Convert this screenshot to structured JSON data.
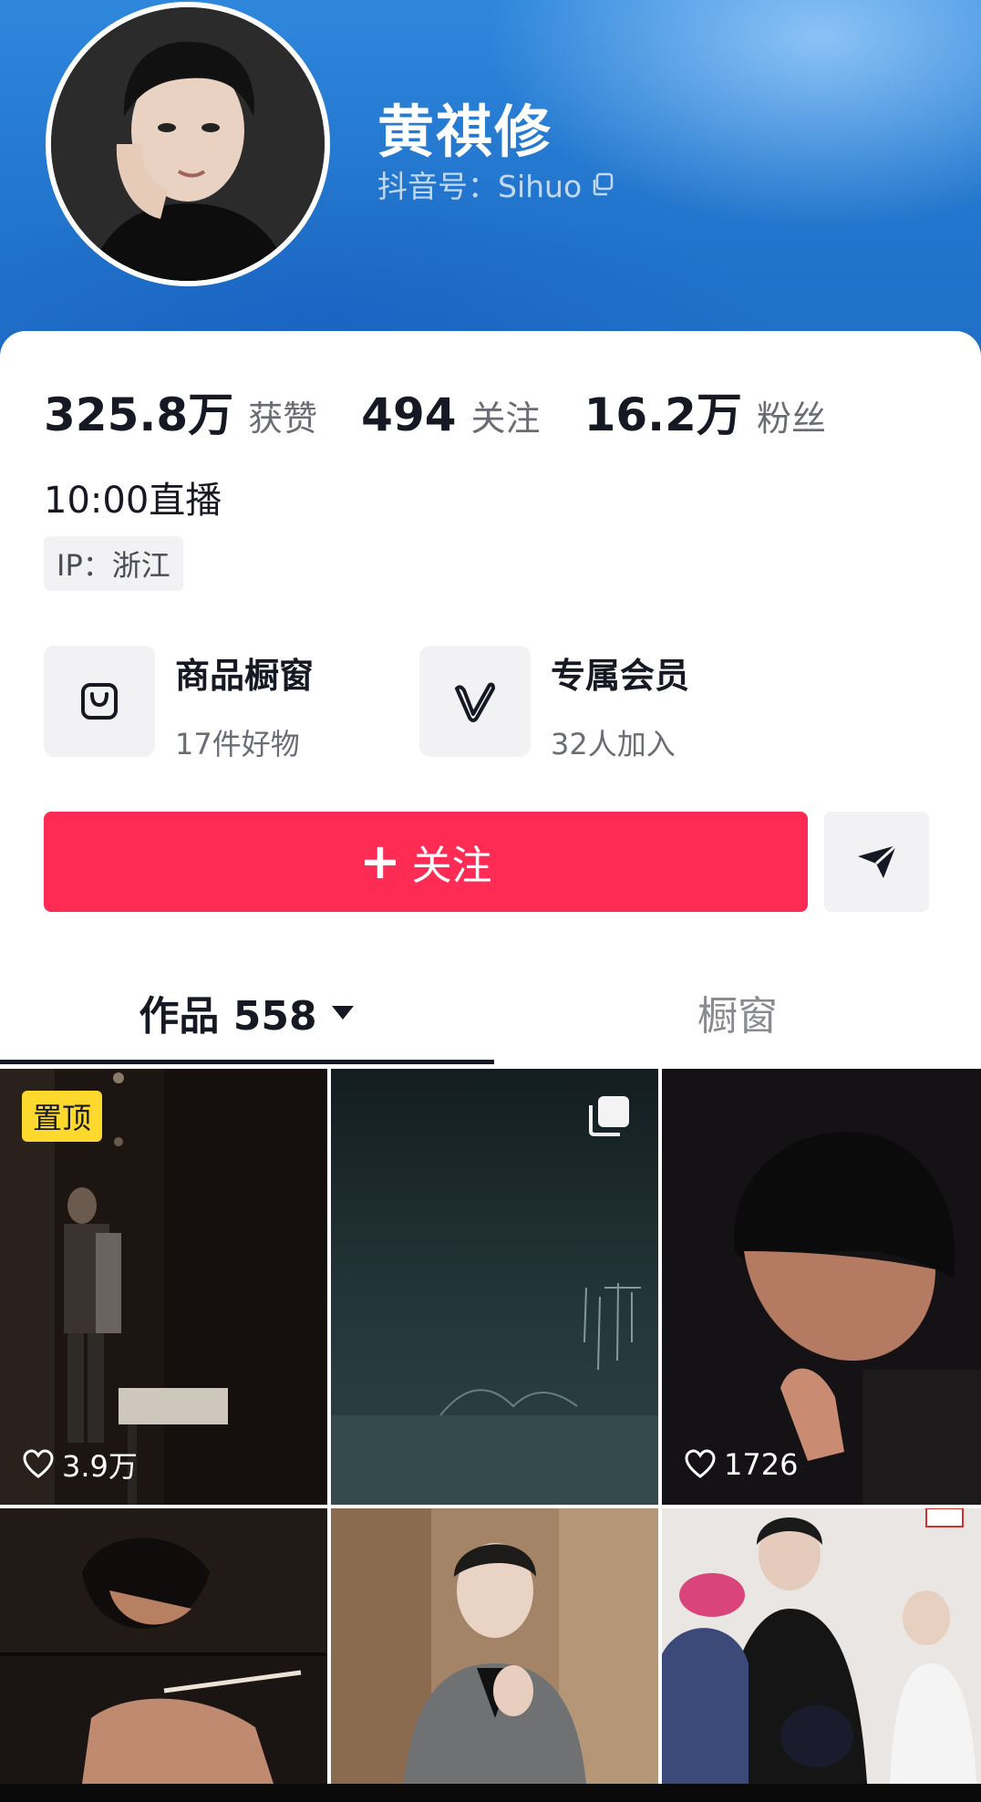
{
  "profile": {
    "name": "黄祺修",
    "douyin_id": "抖音号：Sihuo",
    "avatar_icon": "profile-photo"
  },
  "stats": [
    {
      "value": "325.8万",
      "label": "获赞"
    },
    {
      "value": "494",
      "label": "关注"
    },
    {
      "value": "16.2万",
      "label": "粉丝"
    }
  ],
  "bio": "10:00直播",
  "ip_location": "IP：浙江",
  "features": [
    {
      "icon": "shopping-bag-icon",
      "title": "商品橱窗",
      "subtitle": "17件好物"
    },
    {
      "icon": "vip-icon",
      "title": "专属会员",
      "subtitle": "32人加入"
    }
  ],
  "actions": {
    "follow_plus": "+",
    "follow_label": "关注",
    "share_icon": "send-icon"
  },
  "tabs": [
    {
      "label": "作品 558",
      "active": true,
      "has_dropdown": true
    },
    {
      "label": "橱窗",
      "active": false
    }
  ],
  "grid": [
    {
      "badge": "置顶",
      "likes": "3.9万",
      "description": "man-in-dark-room"
    },
    {
      "multi_image": true,
      "description": "rain-on-water"
    },
    {
      "likes": "1726",
      "description": "closeup-portrait"
    },
    {
      "description": "hands-with-cigarette"
    },
    {
      "description": "man-in-grey-suit"
    },
    {
      "description": "group-photo"
    }
  ],
  "colors": {
    "accent": "#fe2c55",
    "header_blue": "#2478cf",
    "pin_badge": "#fdd92e"
  }
}
